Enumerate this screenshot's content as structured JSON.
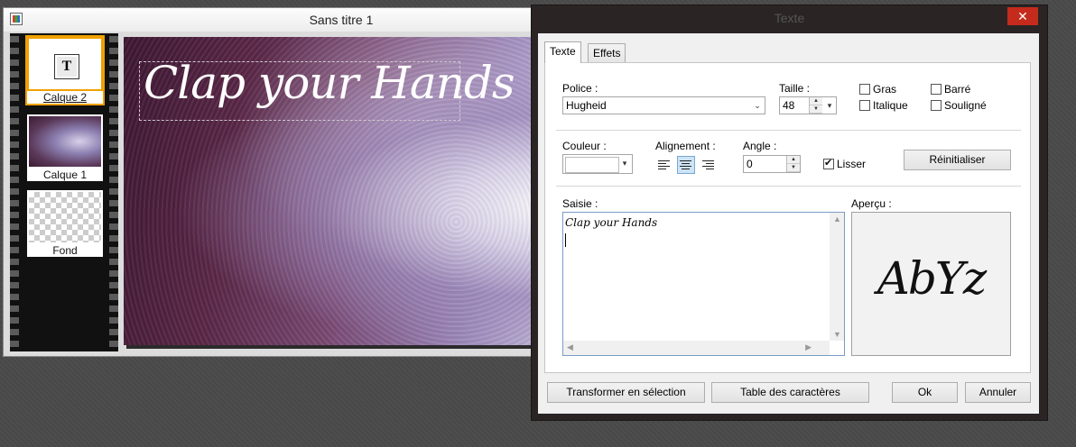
{
  "image_window": {
    "title": "Sans titre 1",
    "controls": {
      "minimize": "—",
      "maximize": "☐",
      "close": "✕"
    },
    "layers": [
      {
        "label": "Calque 2",
        "active": true
      },
      {
        "label": "Calque 1",
        "active": false
      },
      {
        "label": "Fond",
        "active": false
      }
    ],
    "text_layer_glyph": "T",
    "canvas_text": "Clap your Hands"
  },
  "dialog": {
    "title": "Texte",
    "close_glyph": "✕",
    "tabs": {
      "texte": "Texte",
      "effets": "Effets"
    },
    "police_label": "Police :",
    "police_value": "Hugheid",
    "taille_label": "Taille :",
    "taille_value": "48",
    "styles": {
      "gras": "Gras",
      "barre": "Barré",
      "italique": "Italique",
      "souligne": "Souligné"
    },
    "couleur_label": "Couleur :",
    "alignement_label": "Alignement :",
    "alignment_selected": "center",
    "angle_label": "Angle :",
    "angle_value": "0",
    "lisser_label": "Lisser",
    "lisser_checked": true,
    "reinitialiser": "Réinitialiser",
    "saisie_label": "Saisie :",
    "saisie_text": "Clap your Hands",
    "apercu_label": "Aperçu :",
    "apercu_text": "AbYz",
    "buttons": {
      "transformer": "Transformer en sélection",
      "table": "Table des caractères",
      "ok": "Ok",
      "annuler": "Annuler"
    }
  },
  "colors": {
    "accent": "#f0a000",
    "close_red": "#c42b1c",
    "selection_blue": "#cce4f7"
  },
  "icons": [
    "app-icon",
    "text-layer-icon",
    "align-left-icon",
    "align-center-icon",
    "align-right-icon",
    "chevron-down-icon",
    "close-icon"
  ]
}
